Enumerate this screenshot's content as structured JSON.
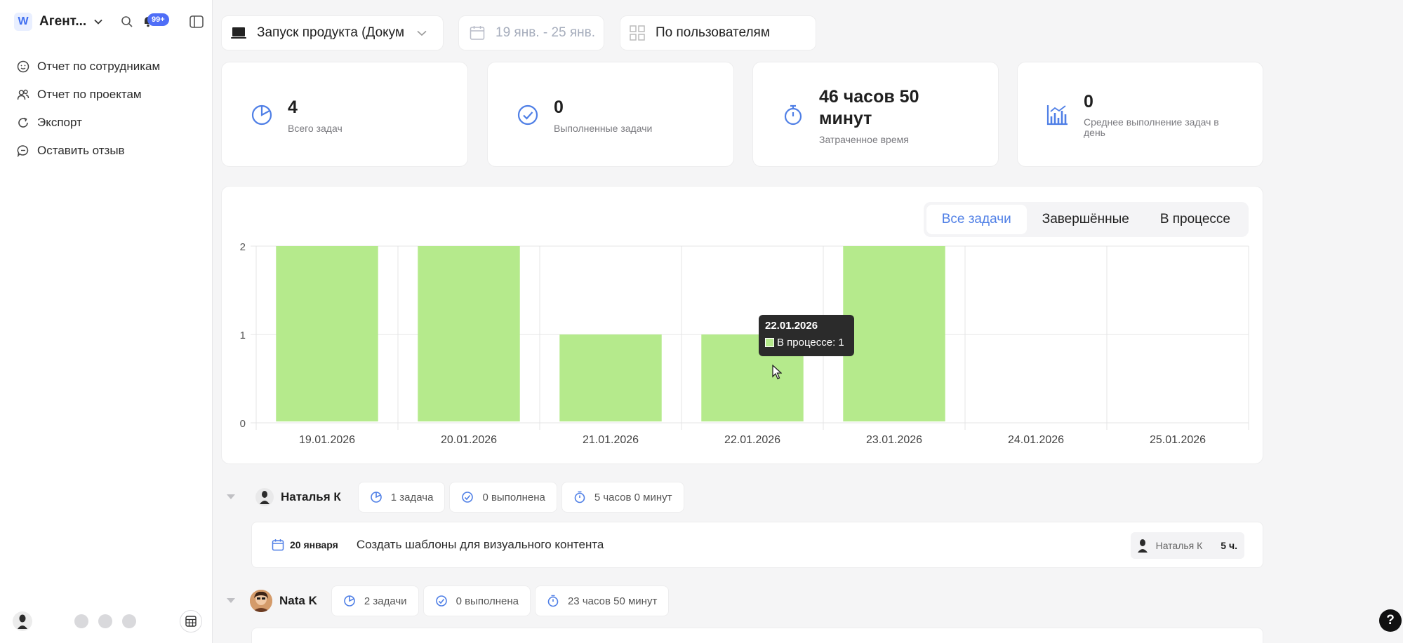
{
  "workspace": {
    "logo": "W",
    "name": "Агент..."
  },
  "notifications": {
    "badge": "99+"
  },
  "nav": [
    {
      "label": "Отчет по сотрудникам",
      "icon": "smile-icon"
    },
    {
      "label": "Отчет по проектам",
      "icon": "users-icon"
    },
    {
      "label": "Экспорт",
      "icon": "refresh-icon"
    },
    {
      "label": "Оставить отзыв",
      "icon": "chat-icon"
    }
  ],
  "filters": {
    "project": "Запуск продукта (Докум",
    "date_range": "19 янв. - 25 янв.",
    "grouping": "По пользователям"
  },
  "stats": [
    {
      "value": "4",
      "label": "Всего задач"
    },
    {
      "value": "0",
      "label": "Выполненные задачи"
    },
    {
      "value": "46 часов 50 минут",
      "label": "Затраченное время"
    },
    {
      "value": "0",
      "label": "Среднее выполнение задач в день"
    }
  ],
  "chart_tabs": [
    "Все задачи",
    "Завершённые",
    "В процессе"
  ],
  "chart_data": {
    "type": "bar",
    "categories": [
      "19.01.2026",
      "20.01.2026",
      "21.01.2026",
      "22.01.2026",
      "23.01.2026",
      "24.01.2026",
      "25.01.2026"
    ],
    "series": [
      {
        "name": "В процессе",
        "values": [
          2,
          2,
          1,
          1,
          2,
          0,
          0
        ],
        "color": "#b5ea8c"
      }
    ],
    "ylim": [
      0,
      2
    ],
    "yticks": [
      "0",
      "1",
      "2"
    ],
    "grid": true
  },
  "tooltip": {
    "date": "22.01.2026",
    "text": "В процессе: 1"
  },
  "groups": [
    {
      "name": "Наталья К",
      "tasks": "1 задача",
      "done": "0 выполнена",
      "time": "5 часов 0 минут"
    },
    {
      "name": "Nata K",
      "tasks": "2 задачи",
      "done": "0 выполнена",
      "time": "23 часов 50 минут"
    }
  ],
  "task": {
    "date": "20 января",
    "title": "Создать шаблоны для визуального контента",
    "assignee": "Наталья К",
    "hours": "5 ч."
  },
  "help": "?"
}
